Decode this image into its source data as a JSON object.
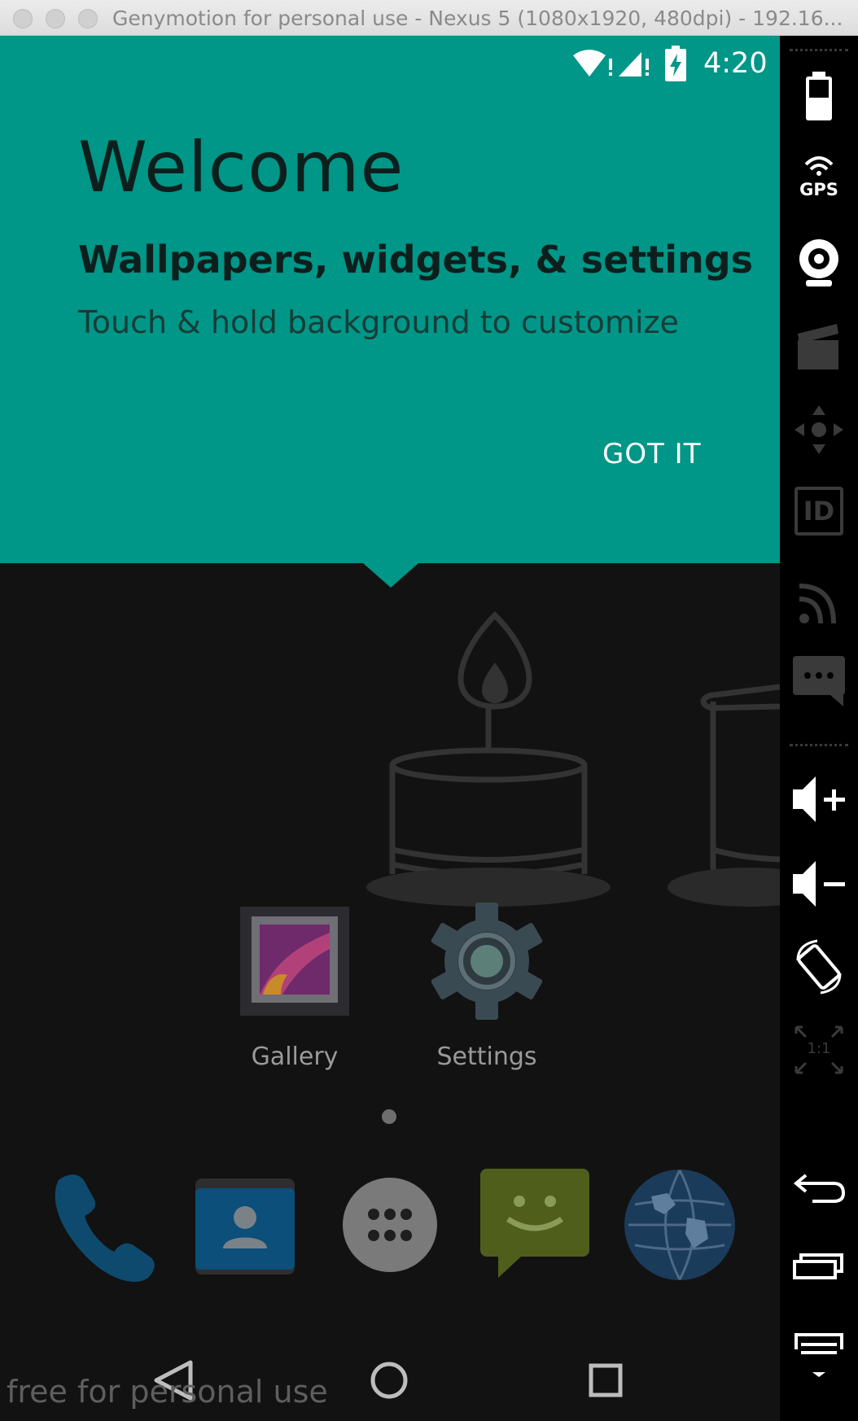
{
  "window": {
    "title": "Genymotion for personal use - Nexus 5 (1080x1920, 480dpi) - 192.16..."
  },
  "status_bar": {
    "time": "4:20",
    "icons": [
      "wifi-icon",
      "cell-signal-icon",
      "battery-charging-icon"
    ]
  },
  "welcome": {
    "title": "Welcome",
    "subtitle": "Wallpapers, widgets, & settings",
    "body": "Touch & hold background to customize",
    "button_label": "GOT IT"
  },
  "home": {
    "apps": [
      {
        "label": "Gallery",
        "icon": "gallery-icon"
      },
      {
        "label": "Settings",
        "icon": "settings-gear-icon"
      }
    ],
    "dock": [
      "phone-icon",
      "contacts-icon",
      "app-drawer-icon",
      "messaging-icon",
      "browser-globe-icon"
    ]
  },
  "navbar": [
    "back-icon",
    "home-icon",
    "recents-icon"
  ],
  "watermark": "free for personal use",
  "sidebar": {
    "tools": [
      "battery-icon",
      "gps-icon",
      "webcam-icon",
      "video-capture-icon",
      "remote-control-icon",
      "device-id-icon",
      "network-icon",
      "sms-icon",
      "volume-up-icon",
      "volume-down-icon",
      "rotate-icon",
      "pixel-perfect-icon",
      "back-icon",
      "recent-apps-icon",
      "menu-icon"
    ],
    "gps_label": "GPS",
    "id_label": "ID",
    "pixel_perfect_label": "1:1"
  },
  "colors": {
    "accent": "#009688",
    "background": "#121212"
  }
}
